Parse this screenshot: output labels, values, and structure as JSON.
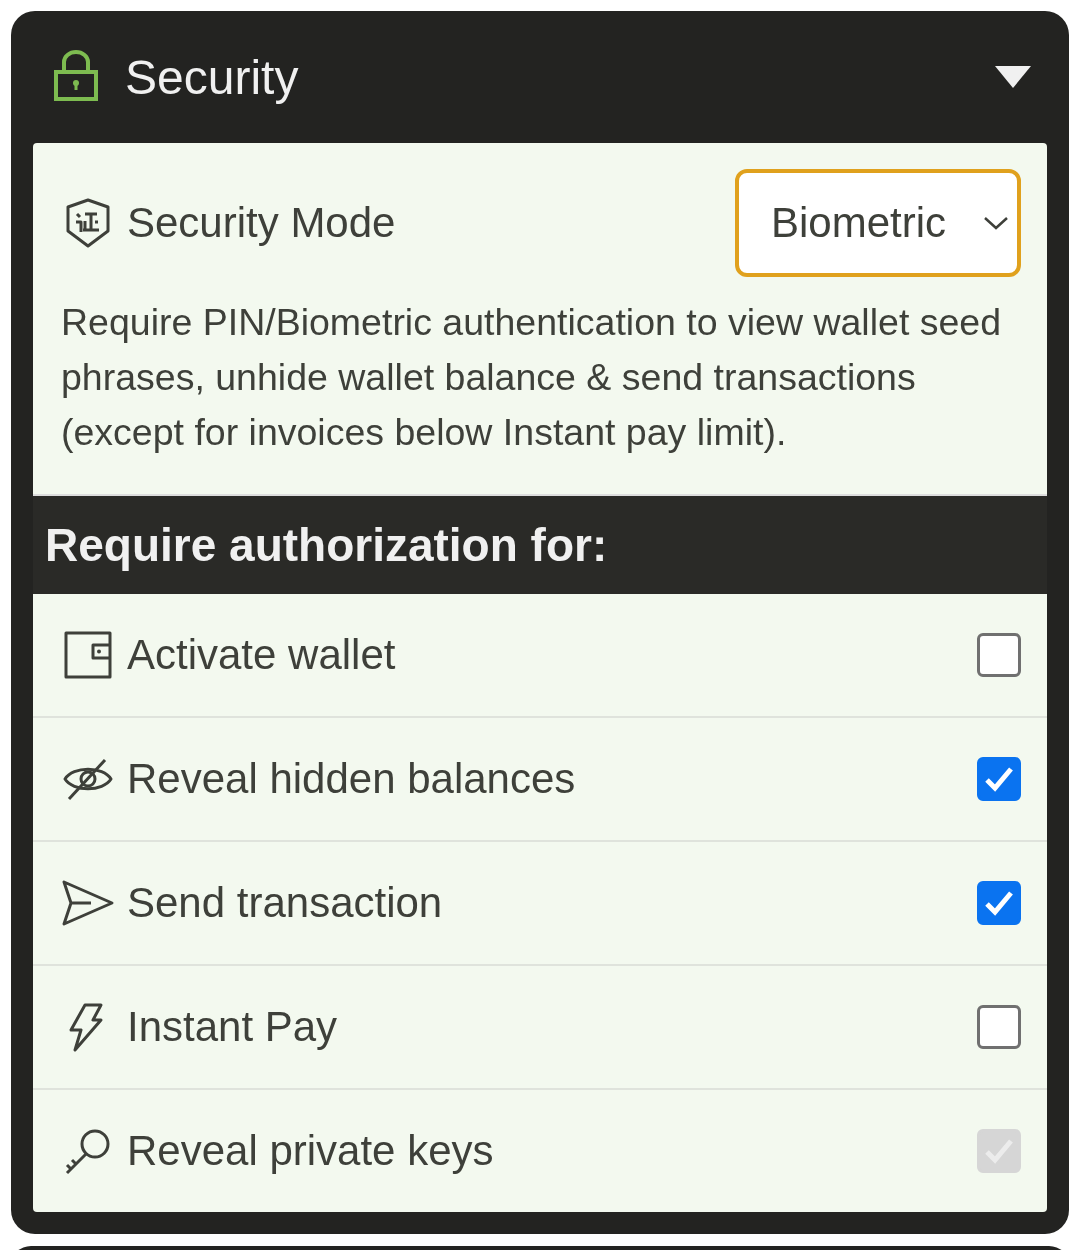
{
  "section": {
    "title": "Security",
    "expanded": true
  },
  "security_mode": {
    "label": "Security Mode",
    "value": "Biometric",
    "description": "Require PIN/Biometric authentication to view wallet seed phrases, unhide wallet balance & send transactions (except for invoices below Instant pay limit)."
  },
  "authorization": {
    "heading": "Require authorization for:",
    "items": [
      {
        "label": "Activate wallet",
        "checked": false,
        "disabled": false
      },
      {
        "label": "Reveal hidden balances",
        "checked": true,
        "disabled": false
      },
      {
        "label": "Send transaction",
        "checked": true,
        "disabled": false
      },
      {
        "label": "Instant Pay",
        "checked": false,
        "disabled": false
      },
      {
        "label": "Reveal private keys",
        "checked": true,
        "disabled": true
      }
    ]
  }
}
